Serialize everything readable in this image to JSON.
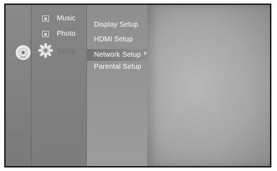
{
  "menu": {
    "main_items": [
      {
        "label": "Music",
        "icon": "music-folder-icon"
      },
      {
        "label": "Photo",
        "icon": "photo-folder-icon"
      },
      {
        "label": "Setup",
        "icon": "gear-icon"
      }
    ],
    "disc_icon": "disc-icon",
    "sub_items": [
      {
        "label": "Display Setup"
      },
      {
        "label": "HDMI Setup"
      },
      {
        "label": "Network Setup"
      },
      {
        "label": "Parental Setup"
      }
    ]
  }
}
